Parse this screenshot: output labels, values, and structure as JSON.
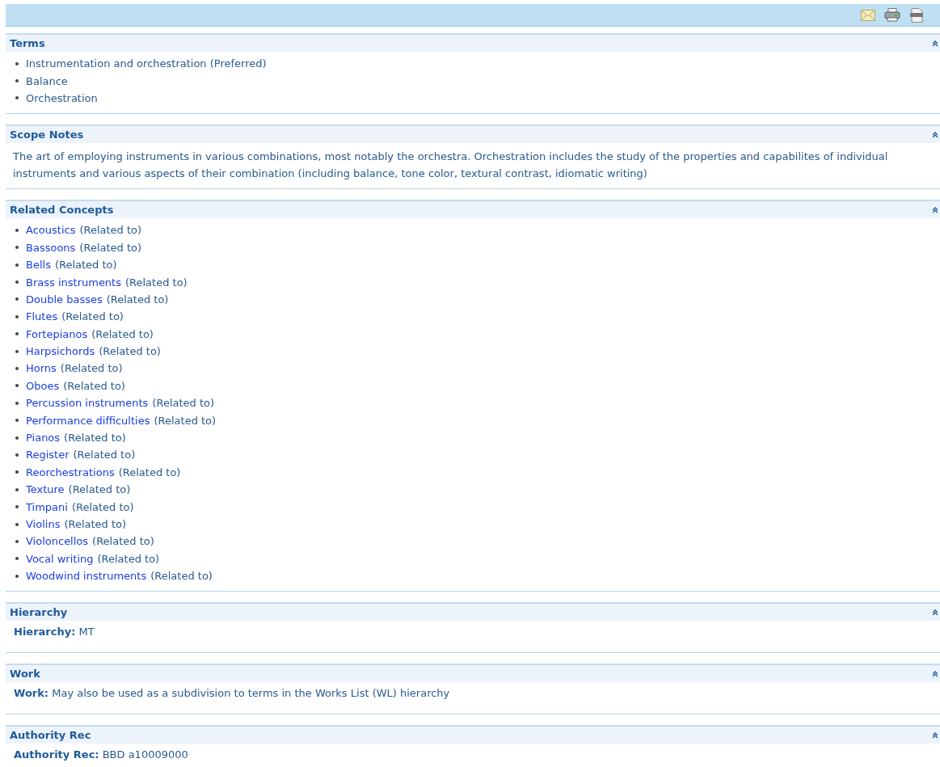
{
  "toolbar": {
    "buttons": [
      {
        "kind": "email"
      },
      {
        "kind": "print"
      },
      {
        "kind": "html"
      }
    ]
  },
  "sections": [
    {
      "title": "Terms",
      "kind": "list",
      "items": [
        {
          "text": "Instrumentation and orchestration (Preferred)"
        },
        {
          "text": "Balance"
        },
        {
          "text": "Orchestration"
        }
      ]
    },
    {
      "title": "Scope Notes",
      "kind": "text",
      "text": "The art of employing instruments in various combinations, most notably the orchestra. Orchestration includes the study of the properties and capabilites of individual instruments and various aspects of their combination (including balance, tone color, textural contrast, idiomatic writing)"
    },
    {
      "title": "Related Concepts",
      "kind": "list",
      "items": [
        {
          "link": "Acoustics",
          "text": "(Related to)"
        },
        {
          "link": "Bassoons",
          "text": "(Related to)"
        },
        {
          "link": "Bells",
          "text": "(Related to)"
        },
        {
          "link": "Brass instruments",
          "text": "(Related to)"
        },
        {
          "link": "Double basses",
          "text": "(Related to)"
        },
        {
          "link": "Flutes",
          "text": "(Related to)"
        },
        {
          "link": "Fortepianos",
          "text": "(Related to)"
        },
        {
          "link": "Harpsichords",
          "text": "(Related to)"
        },
        {
          "link": "Horns",
          "text": "(Related to)"
        },
        {
          "link": "Oboes",
          "text": "(Related to)"
        },
        {
          "link": "Percussion instruments",
          "text": "(Related to)"
        },
        {
          "link": "Performance difficulties",
          "text": "(Related to)"
        },
        {
          "link": "Pianos",
          "text": "(Related to)"
        },
        {
          "link": "Register",
          "text": "(Related to)"
        },
        {
          "link": "Reorchestrations",
          "text": "(Related to)"
        },
        {
          "link": "Texture",
          "text": "(Related to)"
        },
        {
          "link": "Timpani",
          "text": "(Related to)"
        },
        {
          "link": "Violins",
          "text": "(Related to)"
        },
        {
          "link": "Violoncellos",
          "text": "(Related to)"
        },
        {
          "link": "Vocal writing",
          "text": "(Related to)"
        },
        {
          "link": "Woodwind instruments",
          "text": "(Related to)"
        }
      ]
    },
    {
      "title": "Hierarchy",
      "kind": "field",
      "label": "Hierarchy:",
      "value": "MT"
    },
    {
      "title": "Work",
      "kind": "field",
      "label": "Work:",
      "value": "May also be used as a subdivision to terms in the Works List (WL) hierarchy"
    },
    {
      "title": "Authority Rec",
      "kind": "field",
      "label": "Authority Rec:",
      "value": "BBD a10009000"
    }
  ]
}
